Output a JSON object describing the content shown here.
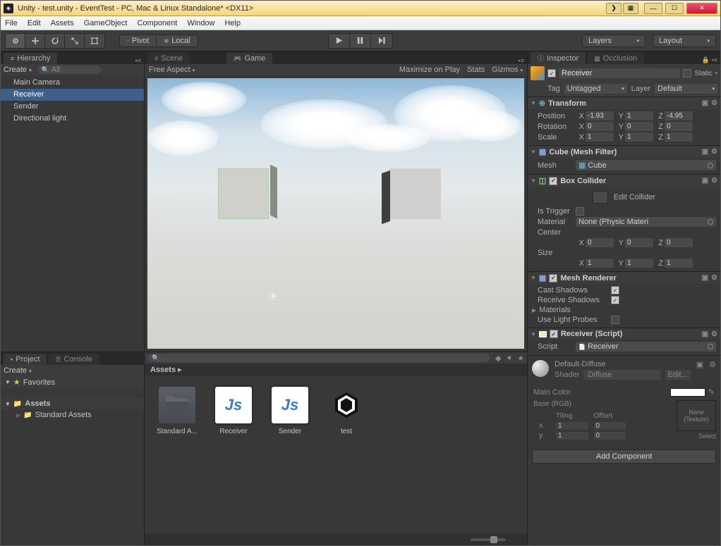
{
  "title": "Unity - test.unity - EventTest - PC, Mac & Linux Standalone* <DX11>",
  "menu": [
    "File",
    "Edit",
    "Assets",
    "GameObject",
    "Component",
    "Window",
    "Help"
  ],
  "toolbar": {
    "pivot": "Pivot",
    "local": "Local",
    "layers": "Layers",
    "layout": "Layout"
  },
  "hierarchy": {
    "tab": "Hierarchy",
    "create": "Create",
    "search": "All",
    "items": [
      "Main Camera",
      "Receiver",
      "Sender",
      "Directional light"
    ],
    "selected_index": 1
  },
  "scene": {
    "tab_scene": "Scene",
    "tab_game": "Game",
    "free_aspect": "Free Aspect",
    "maximize": "Maximize on Play",
    "stats": "Stats",
    "gizmos": "Gizmos"
  },
  "project": {
    "tab_project": "Project",
    "tab_console": "Console",
    "create": "Create",
    "favorites": "Favorites",
    "assets": "Assets",
    "standard_assets": "Standard Assets",
    "crumb": "Assets",
    "items": [
      "Standard A...",
      "Receiver",
      "Sender",
      "test"
    ]
  },
  "inspector": {
    "tab_inspector": "Inspector",
    "tab_occlusion": "Occlusion",
    "name": "Receiver",
    "static": "Static",
    "tag_label": "Tag",
    "tag_value": "Untagged",
    "layer_label": "Layer",
    "layer_value": "Default",
    "transform": {
      "title": "Transform",
      "position": "Position",
      "rotation": "Rotation",
      "scale": "Scale",
      "pos": {
        "x": "-1.93",
        "y": "1",
        "z": "-4.95"
      },
      "rot": {
        "x": "0",
        "y": "0",
        "z": "0"
      },
      "scl": {
        "x": "1",
        "y": "1",
        "z": "1"
      }
    },
    "meshfilter": {
      "title": "Cube (Mesh Filter)",
      "mesh_label": "Mesh",
      "mesh_value": "Cube"
    },
    "boxcollider": {
      "title": "Box Collider",
      "edit": "Edit Collider",
      "istrigger": "Is Trigger",
      "material_label": "Material",
      "material_value": "None (Physic Materi",
      "center": "Center",
      "size": "Size",
      "c": {
        "x": "0",
        "y": "0",
        "z": "0"
      },
      "s": {
        "x": "1",
        "y": "1",
        "z": "1"
      }
    },
    "meshrenderer": {
      "title": "Mesh Renderer",
      "cast": "Cast Shadows",
      "receive": "Receive Shadows",
      "materials": "Materials",
      "uselight": "Use Light Probes"
    },
    "script": {
      "title": "Receiver (Script)",
      "label": "Script",
      "value": "Receiver"
    },
    "material": {
      "title": "Default-Diffuse",
      "shader_label": "Shader",
      "shader_value": "Diffuse",
      "edit": "Edit...",
      "maincolor": "Main Color",
      "base": "Base (RGB)",
      "tiling": "Tiling",
      "offset": "Offset",
      "tx": "1",
      "ty": "1",
      "ox": "0",
      "oy": "0",
      "none_tex": "None\n(Texture)",
      "select": "Select"
    },
    "add_component": "Add Component"
  }
}
